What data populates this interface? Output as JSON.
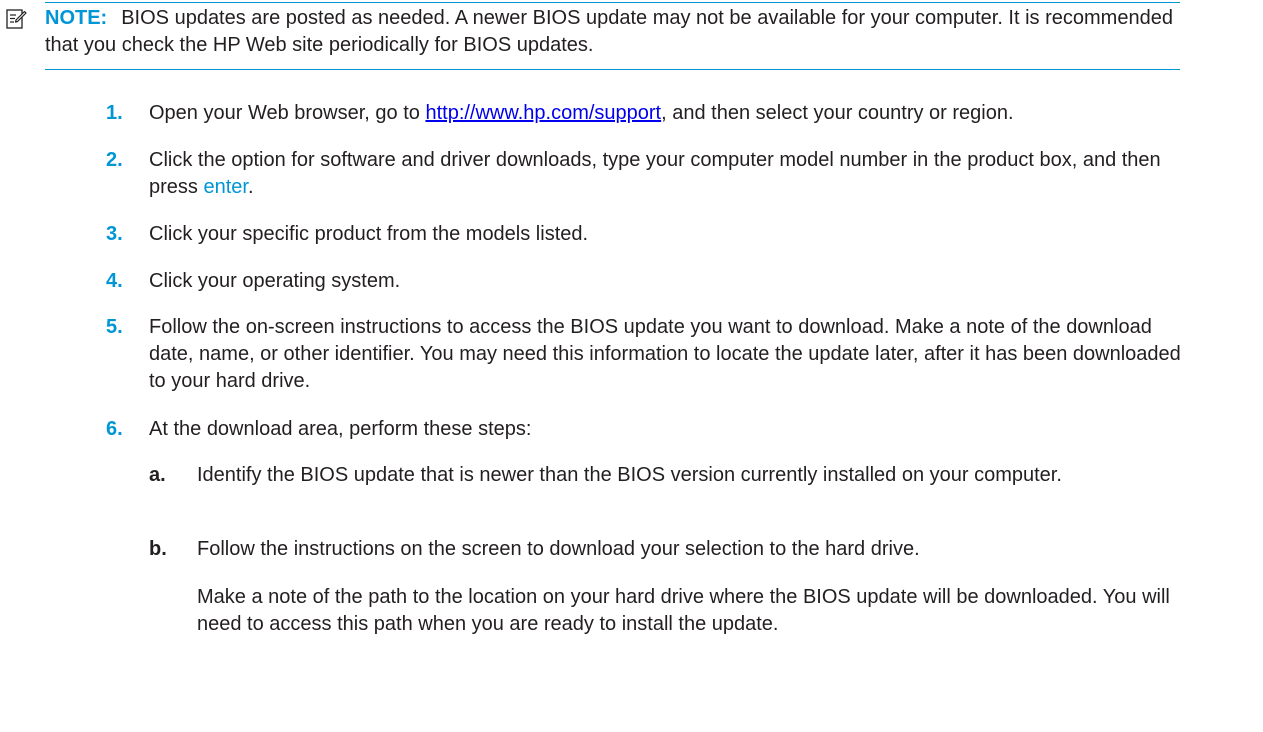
{
  "note": {
    "icon": "note-pencil-icon",
    "label": "NOTE:",
    "text": "BIOS updates are posted as needed. A newer BIOS update may not be available for your computer. It is recommended that you check the HP Web site periodically for BIOS updates."
  },
  "steps": [
    {
      "num": "1.",
      "before": "Open your Web browser, go to ",
      "link": "http://www.hp.com/support",
      "after": ", and then select your country or region."
    },
    {
      "num": "2.",
      "before": "Click the option for software and driver downloads, type your computer model number in the product box, and then press ",
      "key": "enter",
      "after": "."
    },
    {
      "num": "3.",
      "text": "Click your specific product from the models listed."
    },
    {
      "num": "4.",
      "text": "Click your operating system."
    },
    {
      "num": "5.",
      "text": "Follow the on-screen instructions to access the BIOS update you want to download. Make a note of the download date, name, or other identifier. You may need this information to locate the update later, after it has been downloaded to your hard drive."
    },
    {
      "num": "6.",
      "text": "At the download area, perform these steps:"
    }
  ],
  "substeps": [
    {
      "num": "a.",
      "text": "Identify the BIOS update that is newer than the BIOS version currently installed on your computer."
    },
    {
      "num": "b.",
      "text": "Follow the instructions on the screen to download your selection to the hard drive."
    }
  ],
  "closing": "Make a note of the path to the location on your hard drive where the BIOS update will be downloaded. You will need to access this path when you are ready to install the update.",
  "colors": {
    "accent": "#0096d6",
    "text": "#231f20",
    "link": "#0000ee"
  }
}
